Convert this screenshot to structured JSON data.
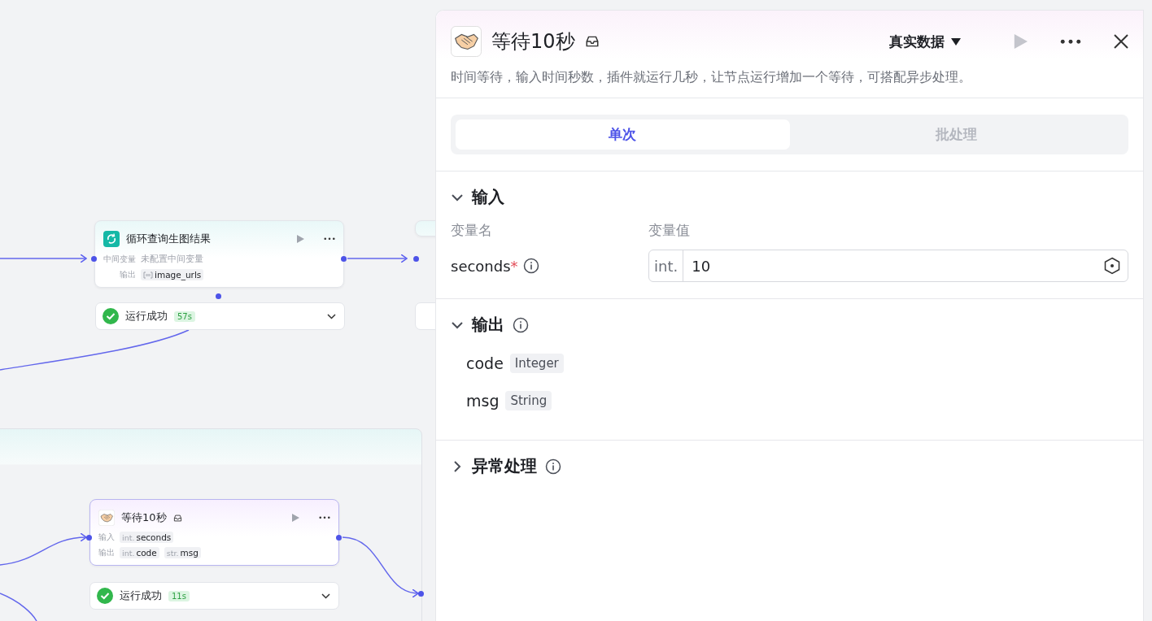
{
  "canvas": {
    "nodes": [
      {
        "kind": "loop",
        "title": "循环查询生图结果",
        "rows": [
          {
            "label": "中间变量",
            "text": "未配置中间变量"
          },
          {
            "label": "输出",
            "tags": [
              {
                "kind": "array",
                "name": "image_urls"
              }
            ]
          }
        ],
        "status": "运行成功",
        "duration": "57s"
      },
      {
        "kind": "plugin",
        "title": "等待10秒",
        "note": true,
        "rows": [
          {
            "label": "输入",
            "tags": [
              {
                "kind": "typed",
                "type": "int.",
                "name": "seconds"
              }
            ]
          },
          {
            "label": "输出",
            "tags": [
              {
                "kind": "typed",
                "type": "int.",
                "name": "code"
              },
              {
                "kind": "typed",
                "type": "str.",
                "name": "msg"
              }
            ]
          }
        ],
        "status": "运行成功",
        "duration": "11s"
      }
    ]
  },
  "panel": {
    "title": "等待10秒",
    "description": "时间等待，输入时间秒数，插件就运行几秒，让节点运行增加一个等待，可搭配异步处理。",
    "data_source": "真实数据",
    "tabs": [
      {
        "label": "单次",
        "selected": true
      },
      {
        "label": "批处理",
        "selected": false
      }
    ],
    "input": {
      "title": "输入",
      "expanded": true,
      "columns": [
        "变量名",
        "变量值"
      ],
      "params": [
        {
          "name": "seconds",
          "required_mark": "*",
          "type": "int.",
          "value": "10"
        }
      ]
    },
    "output": {
      "title": "输出",
      "expanded": true,
      "fields": [
        {
          "name": "code",
          "type": "Integer"
        },
        {
          "name": "msg",
          "type": "String"
        }
      ]
    },
    "error_handling": {
      "title": "异常处理",
      "expanded": false
    }
  }
}
